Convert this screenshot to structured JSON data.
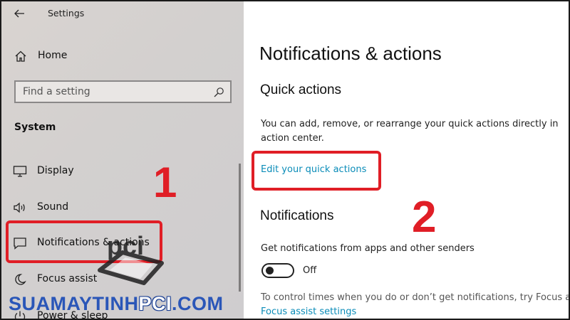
{
  "window": {
    "title": "Settings"
  },
  "sidebar": {
    "home_label": "Home",
    "search_placeholder": "Find a setting",
    "section_label": "System",
    "items": [
      {
        "label": "Display",
        "icon": "monitor-icon"
      },
      {
        "label": "Sound",
        "icon": "speaker-icon"
      },
      {
        "label": "Notifications & actions",
        "icon": "message-icon"
      },
      {
        "label": "Focus assist",
        "icon": "moon-icon"
      },
      {
        "label": "Power & sleep",
        "icon": "power-icon"
      }
    ]
  },
  "content": {
    "page_title": "Notifications & actions",
    "quick_actions": {
      "title": "Quick actions",
      "description": "You can add, remove, or rearrange your quick actions directly in action center.",
      "link": "Edit your quick actions"
    },
    "notifications": {
      "title": "Notifications",
      "description": "Get notifications from apps and other senders",
      "toggle_state": "Off",
      "focus_description": "To control times when you do or don’t get notifications, try Focus assist.",
      "focus_link": "Focus assist settings"
    }
  },
  "annotations": {
    "callout_1": "1",
    "callout_2": "2",
    "color": "#e01e26"
  },
  "watermark": {
    "text_part1": "SUAMAYTINH",
    "text_part2": "PCI",
    "text_part3": ".COM",
    "logo_text": "pci"
  },
  "colors": {
    "accent_link": "#0a8cb8",
    "highlight": "#e01e26"
  }
}
